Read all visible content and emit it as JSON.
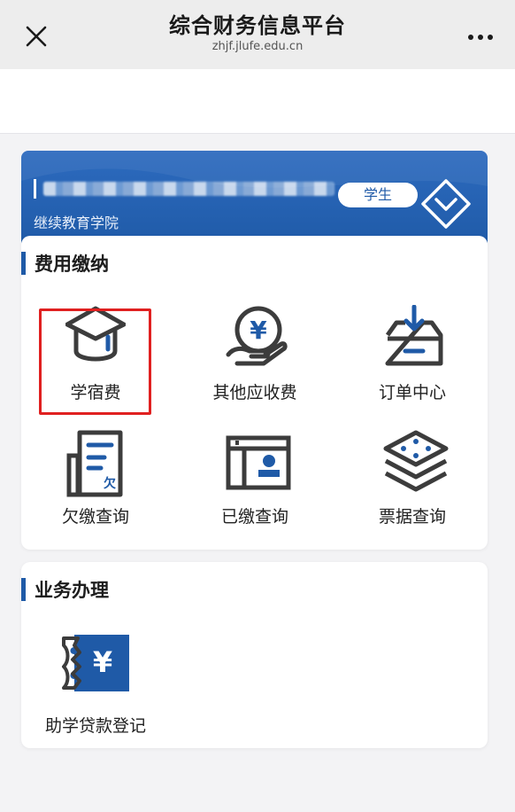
{
  "window": {
    "title": "综合财务信息平台",
    "url": "zhjf.jlufe.edu.cn"
  },
  "profile": {
    "role": "学生",
    "school": "继续教育学院"
  },
  "fee_section": {
    "title": "费用缴纳",
    "tiles": [
      {
        "label": "学宿费",
        "icon": "graduation-cap-icon"
      },
      {
        "label": "其他应收费",
        "icon": "yen-hand-icon"
      },
      {
        "label": "订单中心",
        "icon": "inbox-tray-icon"
      },
      {
        "label": "欠缴查询",
        "icon": "arrears-document-icon"
      },
      {
        "label": "已缴查询",
        "icon": "paid-certificate-icon"
      },
      {
        "label": "票据查询",
        "icon": "stacked-layers-icon"
      }
    ]
  },
  "business_section": {
    "title": "业务办理",
    "tiles": [
      {
        "label": "助学贷款登记",
        "icon": "loan-ticket-icon"
      }
    ]
  },
  "colors": {
    "accent": "#1f5aa7",
    "icon_dark": "#3c3c3c",
    "highlight": "#e02020"
  }
}
